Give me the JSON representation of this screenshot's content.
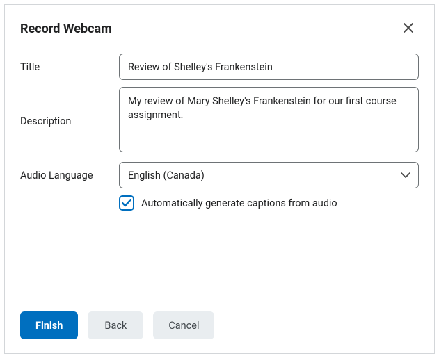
{
  "dialog": {
    "title": "Record Webcam"
  },
  "form": {
    "title_label": "Title",
    "title_value": "Review of Shelley's Frankenstein",
    "description_label": "Description",
    "description_value": "My review of Mary Shelley's Frankenstein for our first course assignment.",
    "language_label": "Audio Language",
    "language_value": "English (Canada)",
    "captions_label": "Automatically generate captions from audio",
    "captions_checked": true
  },
  "footer": {
    "finish": "Finish",
    "back": "Back",
    "cancel": "Cancel"
  }
}
